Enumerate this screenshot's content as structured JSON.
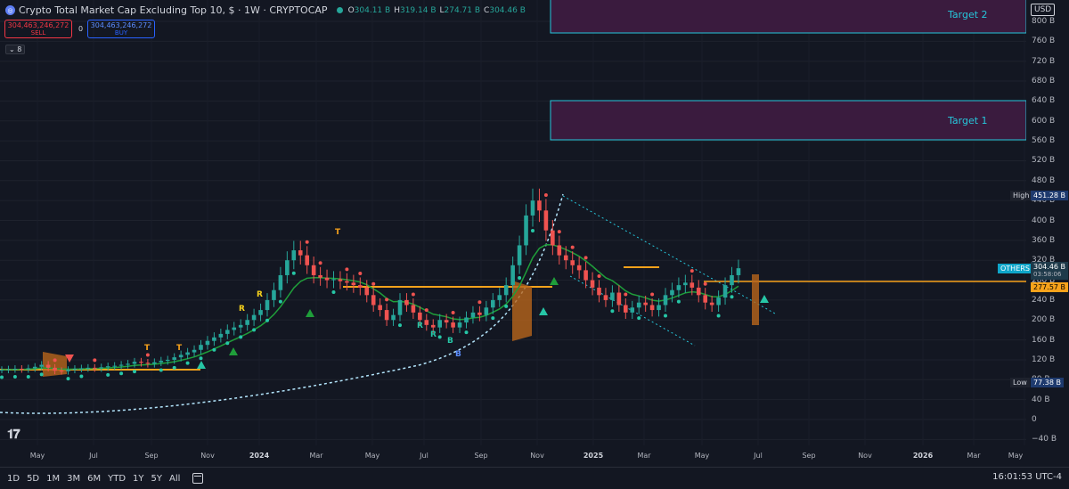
{
  "header": {
    "title": "Crypto Total Market Cap Excluding Top 10, $ · 1W · CRYPTOCAP",
    "ohlc": [
      {
        "key": "O",
        "value": "304.11 B"
      },
      {
        "key": "H",
        "value": "319.14 B"
      },
      {
        "key": "L",
        "value": "274.71 B"
      },
      {
        "key": "C",
        "value": "304.46 B"
      }
    ]
  },
  "trading": {
    "sell_price": "304,463,246,272",
    "sell_label": "SELL",
    "spread": "0",
    "buy_price": "304,463,246,272",
    "buy_label": "BUY"
  },
  "indicators": {
    "count_label": "⌄ 8"
  },
  "currency": "USD",
  "zones": [
    {
      "label": "Target 2"
    },
    {
      "label": "Target 1"
    }
  ],
  "price_axis": {
    "ticks": [
      "800 B",
      "760 B",
      "720 B",
      "680 B",
      "640 B",
      "600 B",
      "560 B",
      "520 B",
      "480 B",
      "440 B",
      "400 B",
      "360 B",
      "320 B",
      "280 B",
      "240 B",
      "200 B",
      "160 B",
      "120 B",
      "80 B",
      "40 B",
      "0",
      "−40 B"
    ],
    "high_tag": "High",
    "high_value": "451.28 B",
    "low_tag": "Low",
    "low_value": "77.38 B",
    "symbol_tag": "OTHERS",
    "last_price": "304.46 B",
    "countdown": "03:58:06",
    "orange_level": "277.57 B"
  },
  "time_axis": {
    "labels": [
      {
        "text": "May",
        "bold": false
      },
      {
        "text": "Jul",
        "bold": false
      },
      {
        "text": "Sep",
        "bold": false
      },
      {
        "text": "Nov",
        "bold": false
      },
      {
        "text": "2024",
        "bold": true
      },
      {
        "text": "Mar",
        "bold": false
      },
      {
        "text": "May",
        "bold": false
      },
      {
        "text": "Jul",
        "bold": false
      },
      {
        "text": "Sep",
        "bold": false
      },
      {
        "text": "Nov",
        "bold": false
      },
      {
        "text": "2025",
        "bold": true
      },
      {
        "text": "Mar",
        "bold": false
      },
      {
        "text": "May",
        "bold": false
      },
      {
        "text": "Jul",
        "bold": false
      },
      {
        "text": "Sep",
        "bold": false
      },
      {
        "text": "Nov",
        "bold": false
      },
      {
        "text": "2026",
        "bold": true
      },
      {
        "text": "Mar",
        "bold": false
      },
      {
        "text": "May",
        "bold": false
      }
    ]
  },
  "bottom": {
    "ranges": [
      "1D",
      "5D",
      "1M",
      "3M",
      "6M",
      "YTD",
      "1Y",
      "5Y",
      "All"
    ],
    "clock": "16:01:53 UTC-4"
  },
  "signals": [
    "T",
    "T",
    "T",
    "R",
    "R",
    "R",
    "R",
    "B"
  ],
  "chart_data": {
    "type": "candlestick",
    "y_unit": "B",
    "ylim": [
      -50,
      820
    ],
    "weekly_closes": [
      100,
      101,
      102,
      101,
      103,
      106,
      110,
      104,
      98,
      97,
      100,
      102,
      103,
      104,
      103,
      105,
      107,
      108,
      110,
      112,
      116,
      114,
      112,
      115,
      118,
      120,
      125,
      130,
      135,
      140,
      150,
      158,
      165,
      172,
      180,
      185,
      190,
      200,
      210,
      220,
      240,
      260,
      290,
      320,
      340,
      330,
      310,
      290,
      285,
      280,
      282,
      278,
      275,
      270,
      265,
      250,
      230,
      220,
      200,
      210,
      240,
      230,
      215,
      200,
      190,
      185,
      200,
      195,
      185,
      195,
      205,
      215,
      210,
      225,
      240,
      250,
      270,
      310,
      350,
      410,
      440,
      420,
      380,
      350,
      330,
      320,
      310,
      300,
      280,
      265,
      250,
      240,
      255,
      230,
      215,
      225,
      235,
      230,
      220,
      230,
      250,
      260,
      270,
      275,
      265,
      250,
      235,
      230,
      245,
      270,
      290,
      304
    ]
  }
}
